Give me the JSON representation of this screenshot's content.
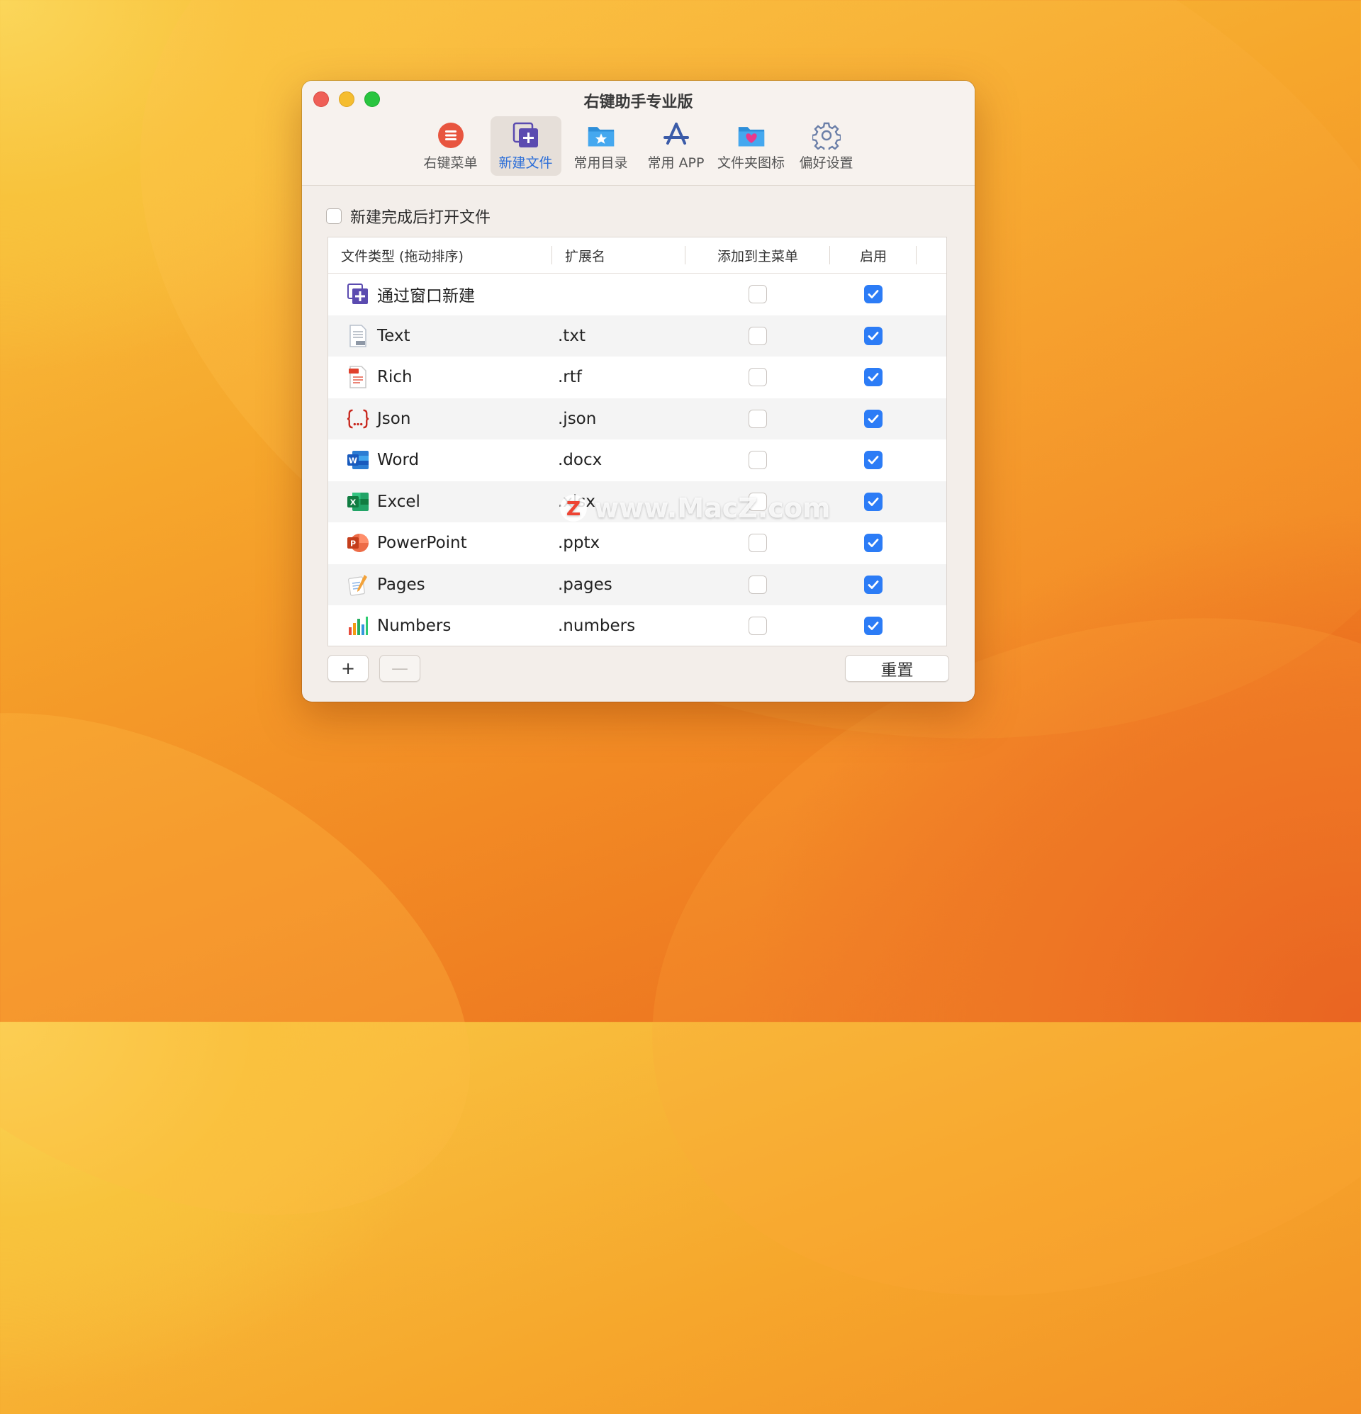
{
  "window": {
    "title": "右键助手专业版"
  },
  "toolbar": {
    "items": [
      {
        "label": "右键菜单",
        "icon": "context-menu-icon",
        "active": false
      },
      {
        "label": "新建文件",
        "icon": "new-file-icon",
        "active": true
      },
      {
        "label": "常用目录",
        "icon": "favorite-folder-icon",
        "active": false
      },
      {
        "label": "常用 APP",
        "icon": "app-store-icon",
        "active": false
      },
      {
        "label": "文件夹图标",
        "icon": "folder-heart-icon",
        "active": false
      },
      {
        "label": "偏好设置",
        "icon": "gear-icon",
        "active": false
      }
    ]
  },
  "options": {
    "open_after_create_label": "新建完成后打开文件",
    "open_after_create_checked": false
  },
  "table": {
    "headers": {
      "type": "文件类型 (拖动排序)",
      "ext": "扩展名",
      "add_to_main": "添加到主菜单",
      "enabled": "启用"
    },
    "rows": [
      {
        "name": "通过窗口新建",
        "ext": "",
        "icon": "new-window-icon",
        "main_menu": false,
        "enabled": true
      },
      {
        "name": "Text",
        "ext": ".txt",
        "icon": "text-file-icon",
        "main_menu": false,
        "enabled": true
      },
      {
        "name": "Rich",
        "ext": ".rtf",
        "icon": "rtf-file-icon",
        "main_menu": false,
        "enabled": true
      },
      {
        "name": "Json",
        "ext": ".json",
        "icon": "json-file-icon",
        "main_menu": false,
        "enabled": true
      },
      {
        "name": "Word",
        "ext": ".docx",
        "icon": "word-icon",
        "main_menu": false,
        "enabled": true
      },
      {
        "name": "Excel",
        "ext": ".xlsx",
        "icon": "excel-icon",
        "main_menu": false,
        "enabled": true
      },
      {
        "name": "PowerPoint",
        "ext": ".pptx",
        "icon": "powerpoint-icon",
        "main_menu": false,
        "enabled": true
      },
      {
        "name": "Pages",
        "ext": ".pages",
        "icon": "pages-icon",
        "main_menu": false,
        "enabled": true
      },
      {
        "name": "Numbers",
        "ext": ".numbers",
        "icon": "numbers-icon",
        "main_menu": false,
        "enabled": true
      }
    ]
  },
  "buttons": {
    "add": "+",
    "remove": "—",
    "reset": "重置"
  },
  "watermark": {
    "logo": "Z",
    "text": "www.MacZ.com"
  },
  "colors": {
    "accent": "#2c7cf6",
    "active_tab_label": "#2e6fd8"
  }
}
